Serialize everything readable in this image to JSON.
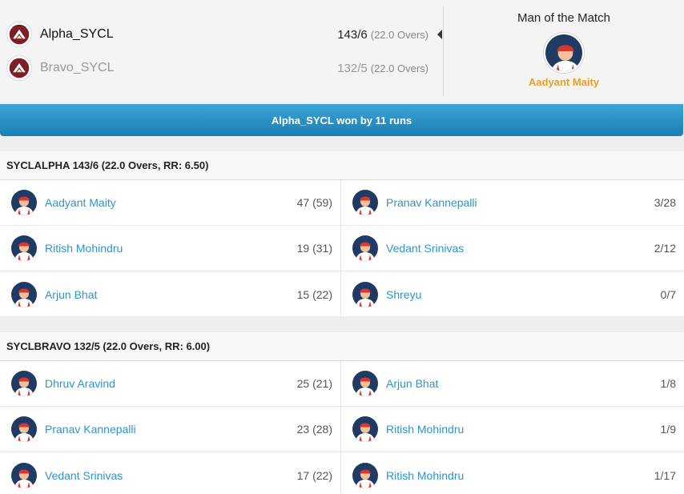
{
  "match": {
    "team_a": {
      "name": "Alpha_SYCL",
      "score": "143/6",
      "overs": "(22.0 Overs)"
    },
    "team_b": {
      "name": "Bravo_SYCL",
      "score": "132/5",
      "overs": "(22.0 Overs)"
    },
    "man_of_match_title": "Man of the Match",
    "man_of_match_name": "Aadyant Maity",
    "result": "Alpha_SYCL won by 11 runs"
  },
  "colors": {
    "link": "#2e94c9",
    "motm": "#e5a129",
    "banner": "#2b92c6"
  },
  "innings": [
    {
      "header": "SYCLALPHA 143/6 (22.0 Overs, RR: 6.50)",
      "batting": [
        {
          "name": "Aadyant Maity",
          "stat": "47 (59)"
        },
        {
          "name": "Ritish Mohindru",
          "stat": "19 (31)"
        },
        {
          "name": "Arjun Bhat",
          "stat": "15 (22)"
        }
      ],
      "bowling": [
        {
          "name": "Pranav Kannepalli",
          "stat": "3/28"
        },
        {
          "name": "Vedant Srinivas",
          "stat": "2/12"
        },
        {
          "name": "Shreyu",
          "stat": "0/7"
        }
      ]
    },
    {
      "header": "SYCLBRAVO 132/5 (22.0 Overs, RR: 6.00)",
      "batting": [
        {
          "name": "Dhruv Aravind",
          "stat": "25 (21)"
        },
        {
          "name": "Pranav Kannepalli",
          "stat": "23 (28)"
        },
        {
          "name": "Vedant Srinivas",
          "stat": "17 (22)"
        }
      ],
      "bowling": [
        {
          "name": "Arjun Bhat",
          "stat": "1/8"
        },
        {
          "name": "Ritish Mohindru",
          "stat": "1/9"
        },
        {
          "name": "Ritish Mohindru",
          "stat": "1/17"
        }
      ]
    }
  ]
}
